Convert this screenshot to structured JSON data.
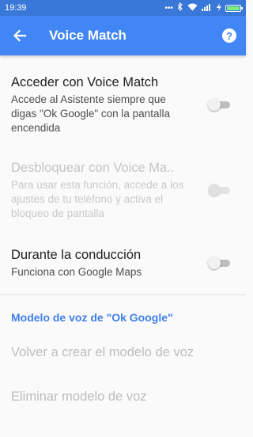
{
  "status_bar": {
    "time": "19:39",
    "icons": [
      "more-dots-icon",
      "bluetooth-icon",
      "wifi-icon",
      "signal-icon",
      "charging-icon",
      "battery-icon"
    ]
  },
  "app_bar": {
    "title": "Voice Match",
    "background": "#4285f4"
  },
  "settings": [
    {
      "title": "Acceder con Voice Match",
      "summary": "Accede al Asistente siempre que digas \"Ok Google\" con la pantalla encendida",
      "enabled": true,
      "checked": false
    },
    {
      "title": "Desbloquear con Voice Ma..",
      "summary": "Para usar esta función, accede a los ajustes de tu teléfono y activa el bloqueo de pantalla",
      "enabled": false,
      "checked": false
    },
    {
      "title": "Durante la conducción",
      "summary": "Funciona con Google Maps",
      "enabled": true,
      "checked": false
    }
  ],
  "voice_model_section": {
    "header": "Modelo de voz de \"Ok Google\"",
    "items": [
      "Volver a crear el modelo de voz",
      "Eliminar modelo de voz"
    ]
  },
  "colors": {
    "accent": "#4285f4",
    "section_header": "#3f7fe8",
    "disabled_text": "#bdbdbd"
  }
}
